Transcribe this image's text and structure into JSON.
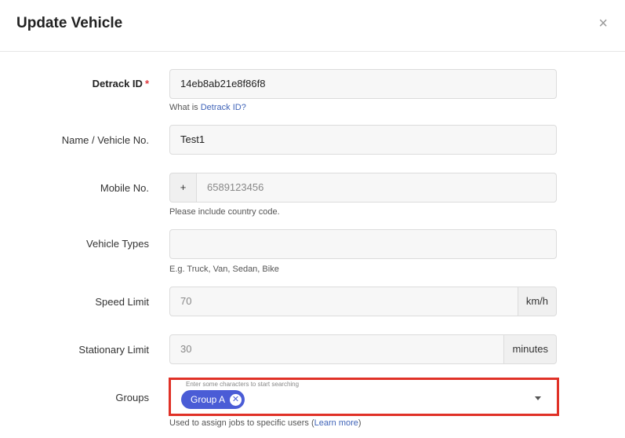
{
  "modal": {
    "title": "Update Vehicle",
    "close_symbol": "×"
  },
  "fields": {
    "detrack_id": {
      "label": "Detrack ID",
      "required_mark": "*",
      "value": "14eb8ab21e8f86f8",
      "help_prefix": "What is ",
      "help_link": "Detrack ID?"
    },
    "name": {
      "label": "Name / Vehicle No.",
      "value": "Test1"
    },
    "mobile": {
      "label": "Mobile No.",
      "prefix": "+",
      "placeholder": "6589123456",
      "help": "Please include country code."
    },
    "vehicle_types": {
      "label": "Vehicle Types",
      "value": "",
      "help": "E.g. Truck, Van, Sedan, Bike"
    },
    "speed_limit": {
      "label": "Speed Limit",
      "placeholder": "70",
      "unit": "km/h"
    },
    "stationary_limit": {
      "label": "Stationary Limit",
      "placeholder": "30",
      "unit": "minutes"
    },
    "groups": {
      "label": "Groups",
      "hint": "Enter some characters to start searching",
      "chips": [
        "Group A"
      ],
      "help_prefix": "Used to assign jobs to specific users (",
      "help_link": "Learn more",
      "help_suffix": ")"
    }
  },
  "colors": {
    "chip": "#4a5cd6",
    "highlight": "#e03127",
    "link": "#3f63b8",
    "required": "#e0393e"
  }
}
